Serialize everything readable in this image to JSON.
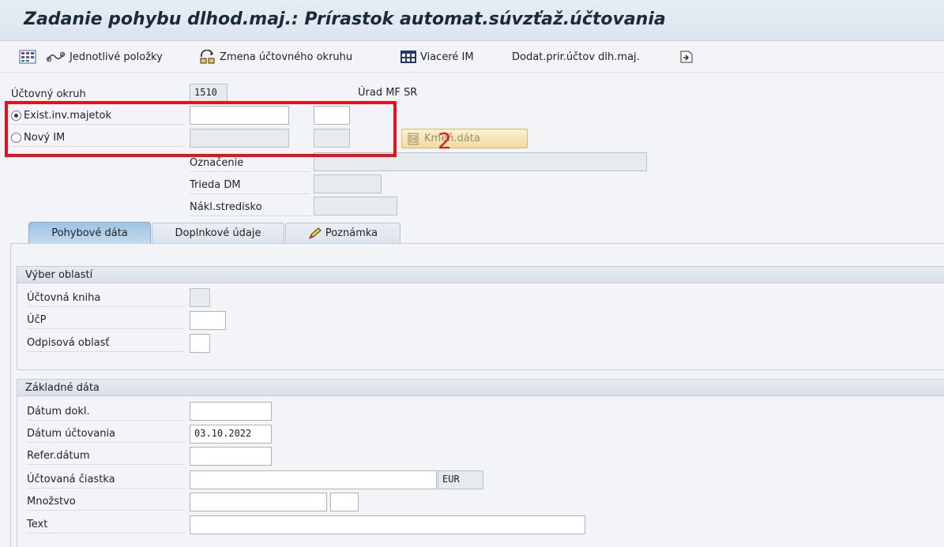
{
  "window": {
    "title": "Zadanie pohybu dlhod.maj.: Prírastok automat.súvzťaž.účtovania"
  },
  "toolbar": {
    "items": [
      {
        "label": "",
        "icon": "multi-grid-icon"
      },
      {
        "label": "Jednotlivé položky",
        "icon": "items-link-icon"
      },
      {
        "label": "Zmena účtovného okruhu",
        "icon": "change-company-code-icon"
      },
      {
        "label": "Viaceré IM",
        "icon": "table-icon"
      },
      {
        "label": "Dodat.prir.účtov dlh.maj.",
        "icon": ""
      },
      {
        "label": "",
        "icon": "export-icon"
      }
    ]
  },
  "header": {
    "company_code_label": "Účtovný okruh",
    "company_code_value": "1510",
    "company_code_name": "Úrad MF SR",
    "existing_asset_label": "Exist.inv.majetok",
    "new_asset_label": "Nový IM",
    "selected_radio": "existing",
    "master_data_button": "Kmeň.dáta",
    "designation_label": "Označenie",
    "asset_class_label": "Trieda DM",
    "cost_center_label": "Nákl.stredisko"
  },
  "annotation": {
    "number": "2",
    "color": "#e8101a"
  },
  "tabs": [
    {
      "label": "Pohybové dáta",
      "active": true
    },
    {
      "label": "Doplnkové údaje",
      "active": false
    },
    {
      "label": "Poznámka",
      "active": false
    }
  ],
  "area_selection": {
    "title": "Výber oblastí",
    "ledger_label": "Účtovná kniha",
    "ucp_label": "ÚčP",
    "depreciation_area_label": "Odpisová oblasť"
  },
  "basic_data": {
    "title": "Základné dáta",
    "document_date_label": "Dátum dokl.",
    "posting_date_label": "Dátum účtovania",
    "posting_date_value": "03.10.2022",
    "reference_date_label": "Refer.dátum",
    "amount_label": "Účtovaná čiastka",
    "currency_value": "EUR",
    "quantity_label": "Množstvo",
    "text_label": "Text"
  }
}
